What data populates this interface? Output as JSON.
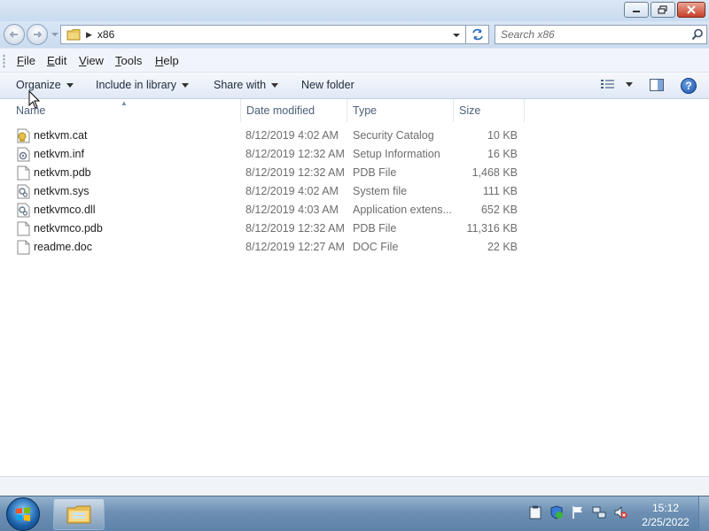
{
  "address": {
    "current_folder": "x86"
  },
  "search": {
    "placeholder": "Search x86"
  },
  "menu": {
    "items": [
      {
        "label": "File",
        "ul": "F",
        "rest": "ile"
      },
      {
        "label": "Edit",
        "ul": "E",
        "rest": "dit"
      },
      {
        "label": "View",
        "ul": "V",
        "rest": "iew"
      },
      {
        "label": "Tools",
        "ul": "T",
        "rest": "ools"
      },
      {
        "label": "Help",
        "ul": "H",
        "rest": "elp"
      }
    ]
  },
  "toolbar": {
    "organize": "Organize",
    "include_in_library": "Include in library",
    "share_with": "Share with",
    "new_folder": "New folder",
    "help": "?"
  },
  "columns": {
    "name": "Name",
    "date": "Date modified",
    "type": "Type",
    "size": "Size"
  },
  "files": [
    {
      "name": "netkvm.cat",
      "date": "8/12/2019 4:02 AM",
      "type": "Security Catalog",
      "size": "10 KB",
      "icon": "catalog-file-icon"
    },
    {
      "name": "netkvm.inf",
      "date": "8/12/2019 12:32 AM",
      "type": "Setup Information",
      "size": "16 KB",
      "icon": "setup-info-file-icon"
    },
    {
      "name": "netkvm.pdb",
      "date": "8/12/2019 12:32 AM",
      "type": "PDB File",
      "size": "1,468 KB",
      "icon": "blank-file-icon"
    },
    {
      "name": "netkvm.sys",
      "date": "8/12/2019 4:02 AM",
      "type": "System file",
      "size": "111 KB",
      "icon": "system-file-icon"
    },
    {
      "name": "netkvmco.dll",
      "date": "8/12/2019 4:03 AM",
      "type": "Application extens...",
      "size": "652 KB",
      "icon": "dll-file-icon"
    },
    {
      "name": "netkvmco.pdb",
      "date": "8/12/2019 12:32 AM",
      "type": "PDB File",
      "size": "11,316 KB",
      "icon": "blank-file-icon"
    },
    {
      "name": "readme.doc",
      "date": "8/12/2019 12:27 AM",
      "type": "DOC File",
      "size": "22 KB",
      "icon": "blank-file-icon"
    }
  ],
  "taskbar": {
    "time": "15:12",
    "date": "2/25/2022"
  }
}
